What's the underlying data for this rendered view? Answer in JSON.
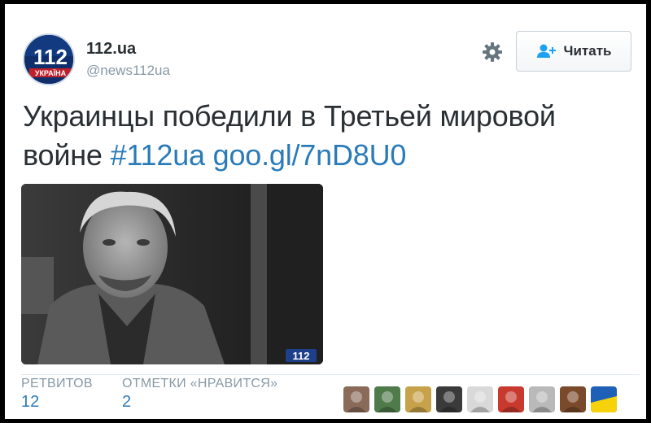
{
  "account": {
    "name": "112.ua",
    "handle": "@news112ua",
    "logo_number": "112",
    "logo_subtitle": "УКРАЇНА"
  },
  "actions": {
    "settings_icon": "gear-icon",
    "follow_label": "Читать",
    "follow_icon": "add-user-icon"
  },
  "tweet": {
    "text": "Украинцы победили в Третьей мировой войне",
    "hashtag": "#112ua",
    "link": "goo.gl/7nD8U0"
  },
  "media": {
    "watermark": "112"
  },
  "stats": {
    "retweets_label": "РЕТВИТОВ",
    "retweets_count": "12",
    "likes_label": "ОТМЕТКИ «НРАВИТСЯ»",
    "likes_count": "2"
  },
  "likers": [
    {
      "name": "liker-avatar-1",
      "color": "#8a6b5a"
    },
    {
      "name": "liker-avatar-2",
      "color": "#4f7a4a"
    },
    {
      "name": "liker-avatar-3",
      "color": "#c7a24a"
    },
    {
      "name": "liker-avatar-4",
      "color": "#3a3a3a"
    },
    {
      "name": "liker-avatar-5",
      "color": "#d9d9d9"
    },
    {
      "name": "liker-avatar-6",
      "color": "#c83a2e"
    },
    {
      "name": "liker-avatar-7",
      "color": "#b9b9b9"
    },
    {
      "name": "liker-avatar-8",
      "color": "#7a4a2a"
    },
    {
      "name": "liker-avatar-9",
      "color": "#1e5fb8"
    }
  ],
  "colors": {
    "link": "#2b7bb9",
    "text": "#292f33",
    "muted": "#8899a6",
    "logo_bg": "#0e2f6b"
  }
}
